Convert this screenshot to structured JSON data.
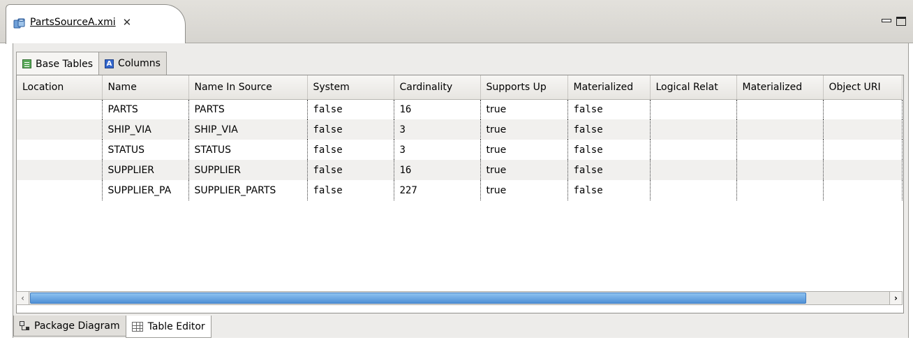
{
  "editor": {
    "file_tab_label": "PartsSourceA.xmi",
    "close_glyph": "✕"
  },
  "inner_tabs": [
    {
      "label": "Base Tables",
      "icon": "table-icon",
      "active": true
    },
    {
      "label": "Columns",
      "icon": "column-icon",
      "active": false
    }
  ],
  "grid": {
    "columns": [
      "Location",
      "Name",
      "Name In Source",
      "System",
      "Cardinality",
      "Supports Up",
      "Materialized",
      "Logical Relat",
      "Materialized",
      "Object URI"
    ],
    "rows": [
      [
        "",
        "PARTS",
        "PARTS",
        "false",
        "16",
        "true",
        "false",
        "",
        "",
        ""
      ],
      [
        "",
        "SHIP_VIA",
        "SHIP_VIA",
        "false",
        "3",
        "true",
        "false",
        "",
        "",
        ""
      ],
      [
        "",
        "STATUS",
        "STATUS",
        "false",
        "3",
        "true",
        "false",
        "",
        "",
        ""
      ],
      [
        "",
        "SUPPLIER",
        "SUPPLIER",
        "false",
        "16",
        "true",
        "false",
        "",
        "",
        ""
      ],
      [
        "",
        "SUPPLIER_PA",
        "SUPPLIER_PARTS",
        "false",
        "227",
        "true",
        "false",
        "",
        "",
        ""
      ]
    ]
  },
  "page_tabs": [
    {
      "label": "Package Diagram",
      "icon": "diagram-icon",
      "active": false
    },
    {
      "label": "Table Editor",
      "icon": "grid-icon",
      "active": true
    }
  ]
}
